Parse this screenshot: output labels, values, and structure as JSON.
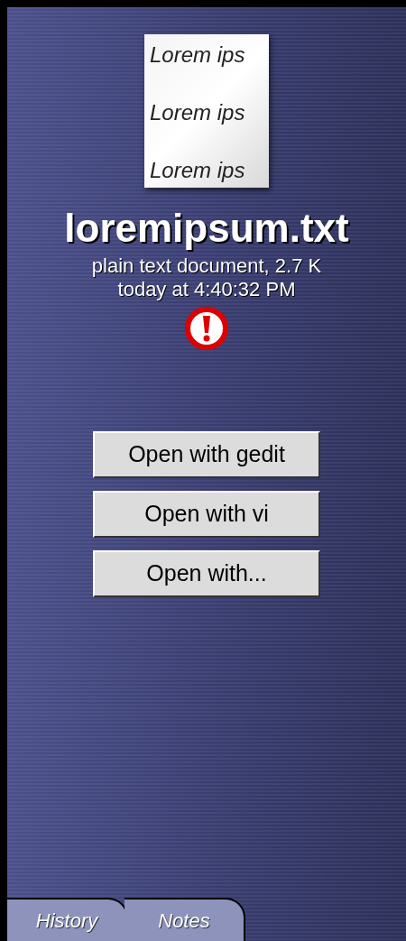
{
  "preview": {
    "lines": [
      "Lorem ips",
      "Lorem ips",
      "Lorem ips"
    ]
  },
  "file": {
    "name": "loremipsum.txt",
    "description": "plain text document, 2.7 K",
    "modified": "today at 4:40:32 PM",
    "warning": true
  },
  "buttons": [
    "Open with gedit",
    "Open with vi",
    "Open with..."
  ],
  "tabs": [
    {
      "label": "History",
      "selected": false
    },
    {
      "label": "Notes",
      "selected": false
    }
  ]
}
